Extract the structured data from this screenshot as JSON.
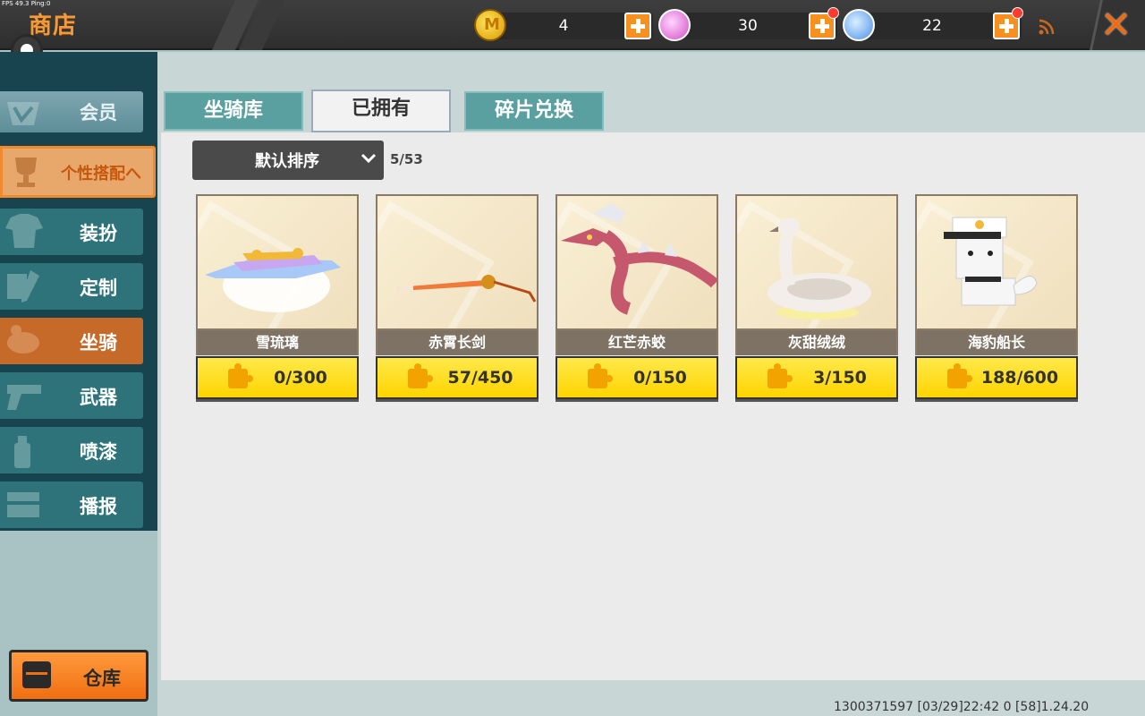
{
  "debug": {
    "fps": "FPS 49.3  Ping:0"
  },
  "header": {
    "title": "商店",
    "currencies": [
      {
        "name": "coin-icon",
        "value": "4",
        "badge": false,
        "color": "#f2b800"
      },
      {
        "name": "pink-gem-icon",
        "value": "30",
        "badge": true,
        "color": "#d44cc5"
      },
      {
        "name": "blue-gem-icon",
        "value": "22",
        "badge": true,
        "color": "#4c8ee8"
      }
    ],
    "close_glyph": "✕"
  },
  "sidebar": {
    "items": [
      {
        "label": "会员",
        "icon": "vip-icon"
      },
      {
        "label": "个性搭配へ",
        "icon": "trophy-icon"
      },
      {
        "label": "装扮",
        "icon": "shirt-icon"
      },
      {
        "label": "定制",
        "icon": "pencil-icon"
      },
      {
        "label": "坐骑",
        "icon": "saddle-icon"
      },
      {
        "label": "武器",
        "icon": "gun-icon"
      },
      {
        "label": "喷漆",
        "icon": "spray-can-icon"
      },
      {
        "label": "播报",
        "icon": "broadcast-icon"
      }
    ],
    "warehouse_label": "仓库"
  },
  "tabs": [
    {
      "label": "坐骑库"
    },
    {
      "label": "已拥有"
    },
    {
      "label": "碎片兑换"
    }
  ],
  "sort": {
    "label": "默认排序",
    "count": "5/53"
  },
  "cards": [
    {
      "name": "雪琉璃",
      "progress": "0/300"
    },
    {
      "name": "赤霄长剑",
      "progress": "57/450"
    },
    {
      "name": "红芒赤蛟",
      "progress": "0/150"
    },
    {
      "name": "灰甜绒绒",
      "progress": "3/150"
    },
    {
      "name": "海豹船长",
      "progress": "188/600"
    }
  ],
  "footer": {
    "info": "1300371597    [03/29]22:42 0 [58]1.24.20"
  },
  "colors": {
    "accent": "#f39a3a",
    "tab_active": "#f2f2f2",
    "tab_inactive": "#5aa0a0",
    "progress_yellow": "#ffd500"
  }
}
